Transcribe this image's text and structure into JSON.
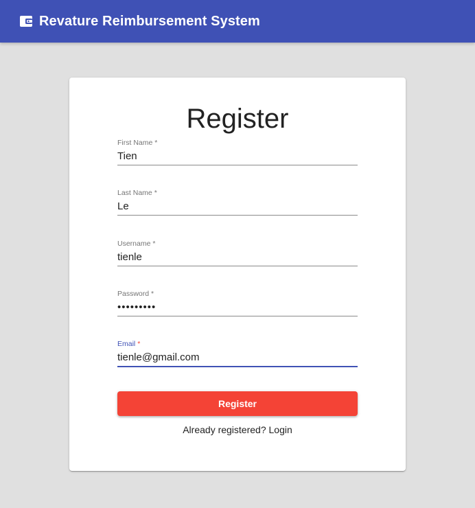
{
  "appbar": {
    "title": "Revature Reimbursement System",
    "icon": "wallet-icon",
    "color": "#3f51b5"
  },
  "form": {
    "heading": "Register",
    "fields": [
      {
        "label": "First Name",
        "required_mark": "*",
        "value": "Tien",
        "type": "text"
      },
      {
        "label": "Last Name",
        "required_mark": "*",
        "value": "Le",
        "type": "text"
      },
      {
        "label": "Username",
        "required_mark": "*",
        "value": "tienle",
        "type": "text"
      },
      {
        "label": "Password",
        "required_mark": "*",
        "value": "tienle123",
        "type": "password"
      },
      {
        "label": "Email",
        "required_mark": "*",
        "value": "tienle@gmail.com",
        "type": "email",
        "focused": true
      }
    ],
    "submit_label": "Register",
    "submit_color": "#f44336",
    "login_link": "Already registered? Login"
  }
}
